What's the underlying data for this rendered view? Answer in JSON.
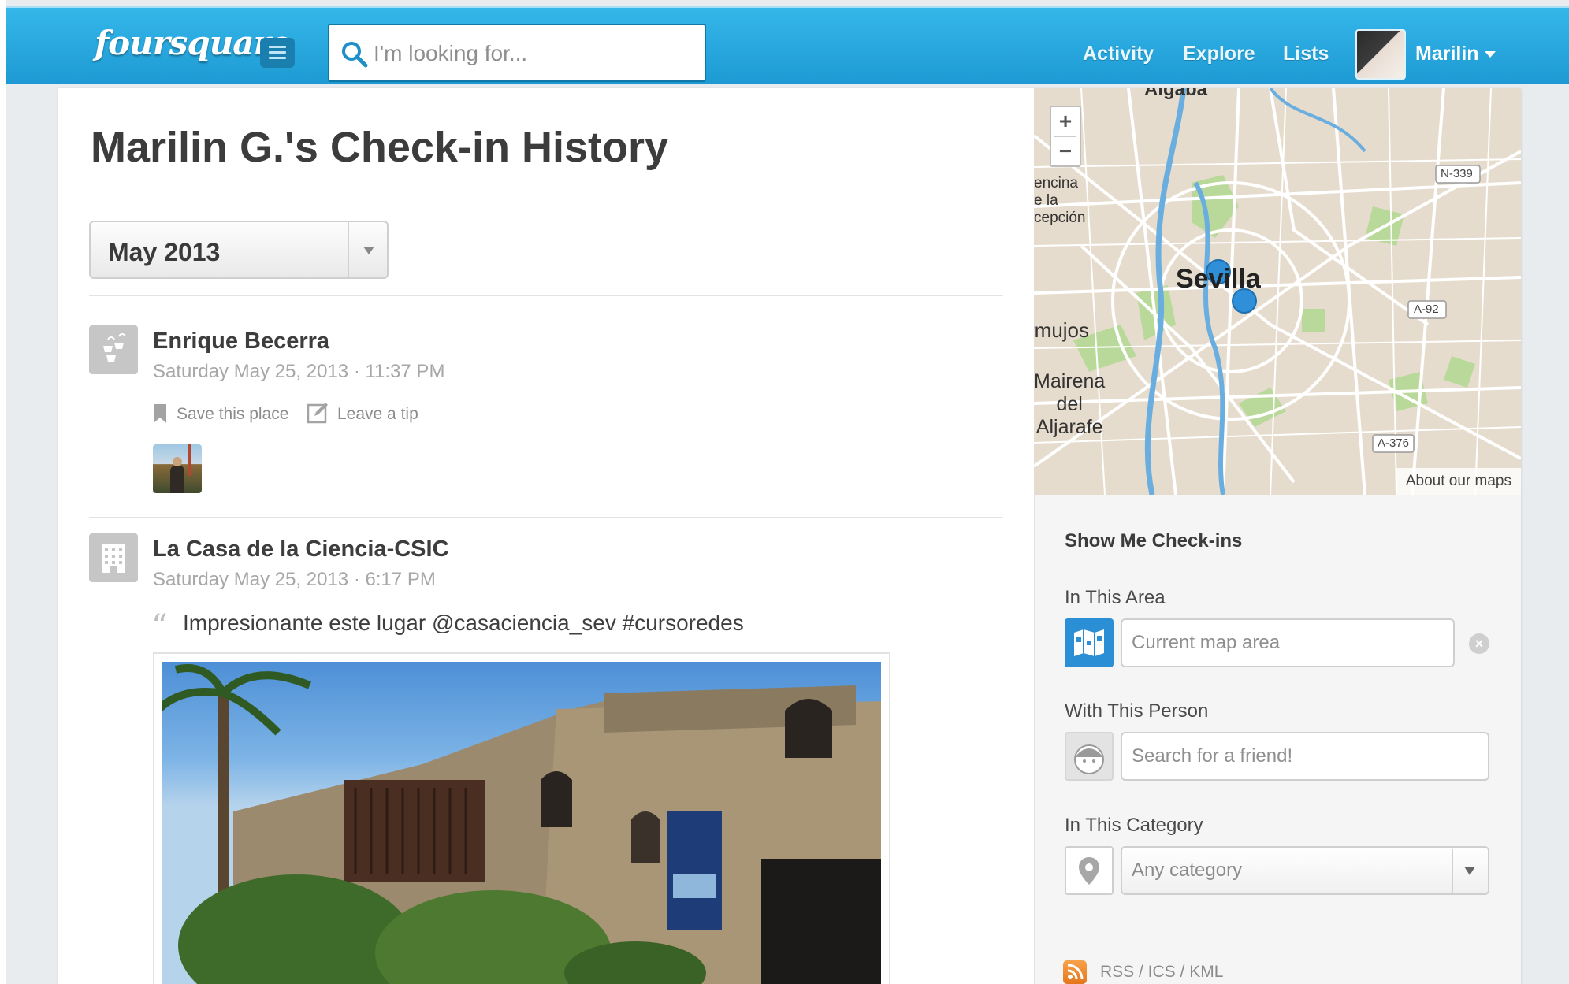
{
  "header": {
    "logo_text": "foursquare",
    "search_placeholder": "I'm looking for...",
    "nav": [
      "Activity",
      "Explore",
      "Lists"
    ],
    "user_name": "Marilin"
  },
  "page": {
    "title": "Marilin G.'s Check-in History",
    "month_filter": "May 2013"
  },
  "checkins": [
    {
      "venue": "Enrique Becerra",
      "timestamp": "Saturday May 25, 2013 · 11:37 PM",
      "actions": [
        "Save this place",
        "Leave a tip"
      ]
    },
    {
      "venue": "La Casa de la Ciencia-CSIC",
      "timestamp": "Saturday May 25, 2013 · 6:17 PM",
      "comment": "Impresionante este lugar @casaciencia_sev #cursoredes"
    }
  ],
  "map": {
    "zoom_in": "+",
    "zoom_out": "−",
    "labels": {
      "city": "Sevilla",
      "algaba": "Algaba",
      "encina": "encina\ne la\ncepción",
      "mujos": "rmujos",
      "mairena": "Mairena\ndel\nAljarafe",
      "road_n339": "N-339",
      "road_a92": "A-92",
      "road_a376": "A-376"
    },
    "about": "About our maps"
  },
  "sidebar": {
    "heading": "Show Me Check-ins",
    "area_label": "In This Area",
    "area_placeholder": "Current map area",
    "person_label": "With This Person",
    "person_placeholder": "Search for a friend!",
    "category_label": "In This Category",
    "category_value": "Any category",
    "feeds_link": "RSS / ICS / KML"
  },
  "colors": {
    "brand_blue": "#2aa8e0",
    "pin_blue": "#2f8fd8",
    "rss_orange": "#f08a2a"
  }
}
